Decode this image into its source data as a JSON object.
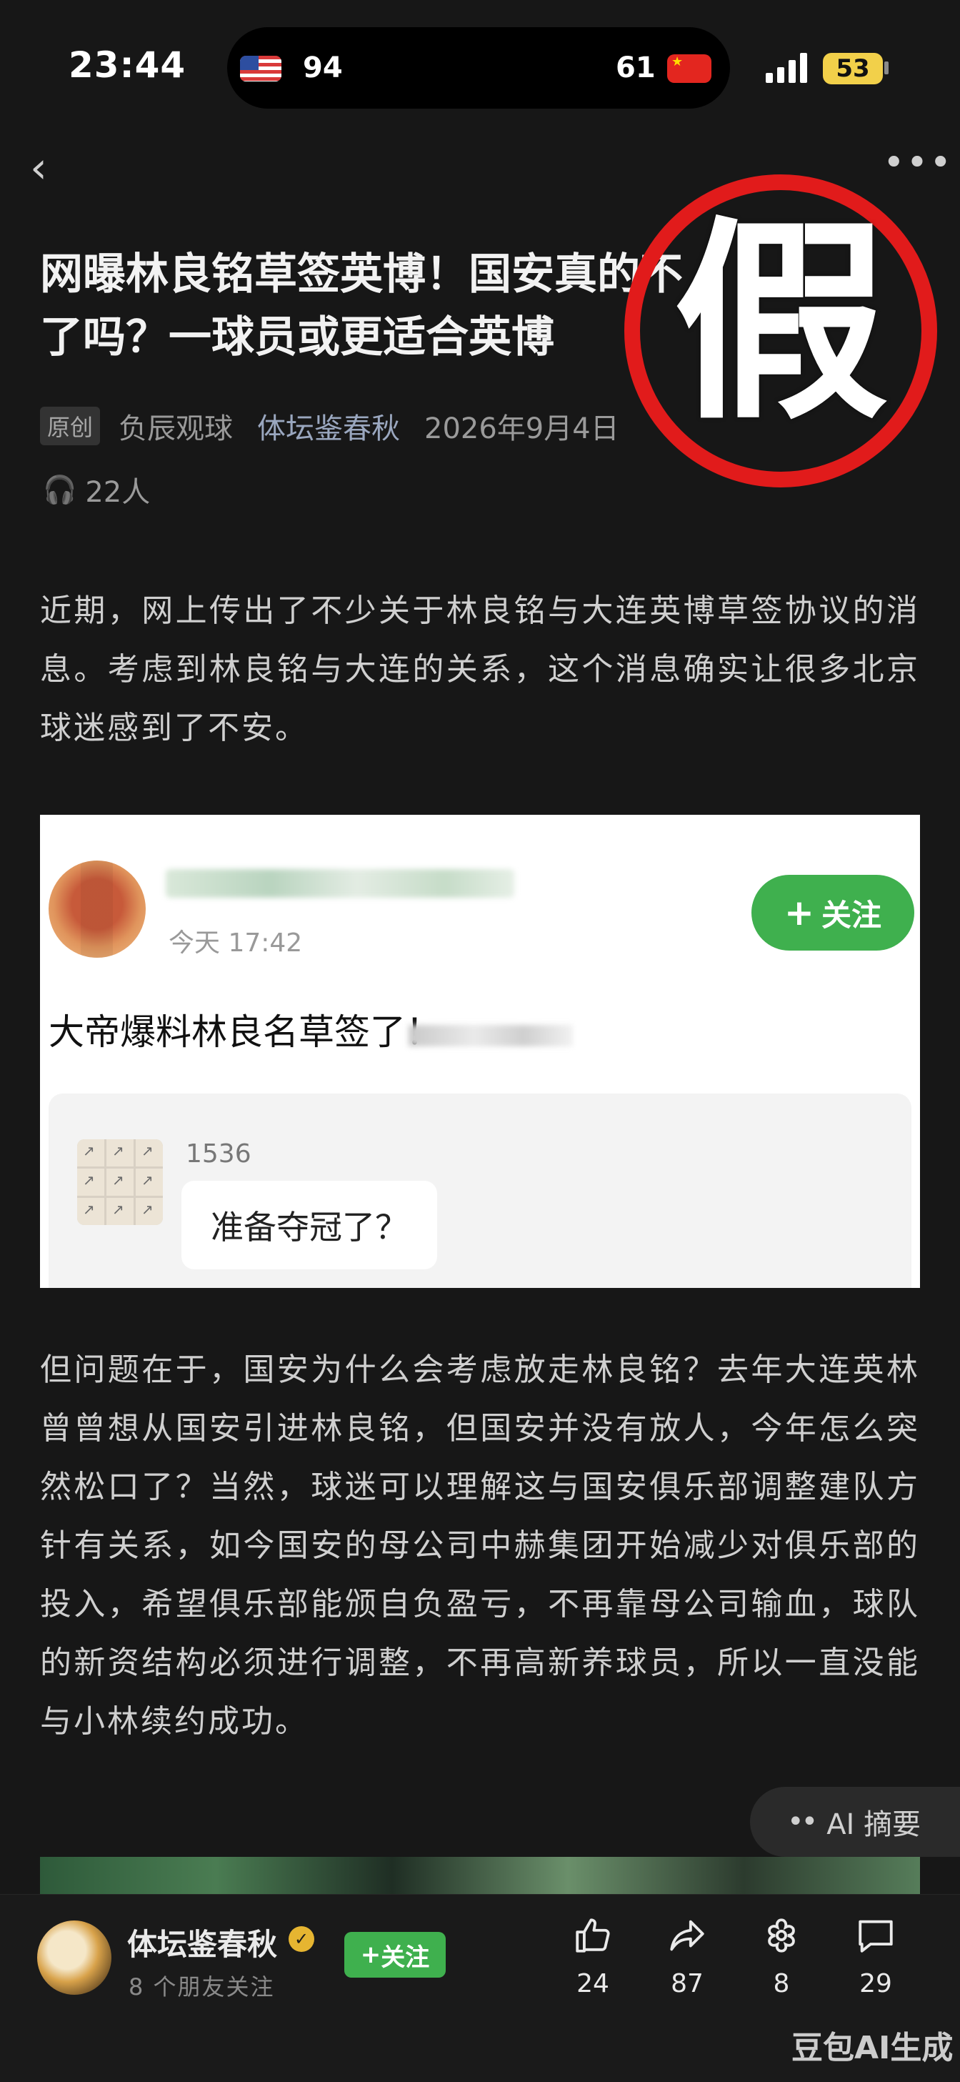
{
  "status_bar": {
    "time": "23:44",
    "score_left": "94",
    "score_right": "61",
    "battery": "53"
  },
  "nav": {
    "back_icon": "chevron-left-icon",
    "more_icon": "more-dots-icon"
  },
  "article": {
    "title": "网曝林良铭草签英博！国安真的不要他了吗？一球员或更适合英博",
    "title_line1": "网曝林良铭草签英博！国安真的不",
    "title_line2": "了吗？一球员或更适合英博",
    "original_badge": "原创",
    "column": "负辰观球",
    "account": "体坛鉴春秋",
    "date": "2026年9月4日",
    "listeners": "22人",
    "para1": "近期，网上传出了不少关于林良铭与大连英博草签协议的消息。考虑到林良铭与大连的关系，这个消息确实让很多北京球迷感到了不安。",
    "para2": "但问题在于，国安为什么会考虑放走林良铭？去年大连英林曾曾想从国安引进林良铭，但国安并没有放人，今年怎么突然松口了？当然，球迷可以理解这与国安俱乐部调整建队方针有关系，如今国安的母公司中赫集团开始减少对俱乐部的投入，希望俱乐部能颁自负盈亏，不再靠母公司输血，球队的新资结构必须进行调整，不再高新养球员，所以一直没能与小林续约成功。"
  },
  "stamp": {
    "text": "假",
    "color": "#e11b1b"
  },
  "embedded_post": {
    "time": "今天 17:42",
    "follow_label": "关注",
    "text": "大帝爆料林良名草签了！",
    "quote_count": "1536",
    "quote_text": "准备夺冠了？"
  },
  "ai_summary": {
    "label": "AI 摘要"
  },
  "bottom_bar": {
    "author": "体坛鉴春秋",
    "friends": "8 个朋友关注",
    "follow_label": "关注",
    "likes": "24",
    "shares": "87",
    "gifts": "8",
    "comments": "29"
  },
  "watermark": "豆包AI生成",
  "colors": {
    "background": "#171717",
    "accent_green": "#3fb04e",
    "stamp_red": "#e11b1b"
  }
}
